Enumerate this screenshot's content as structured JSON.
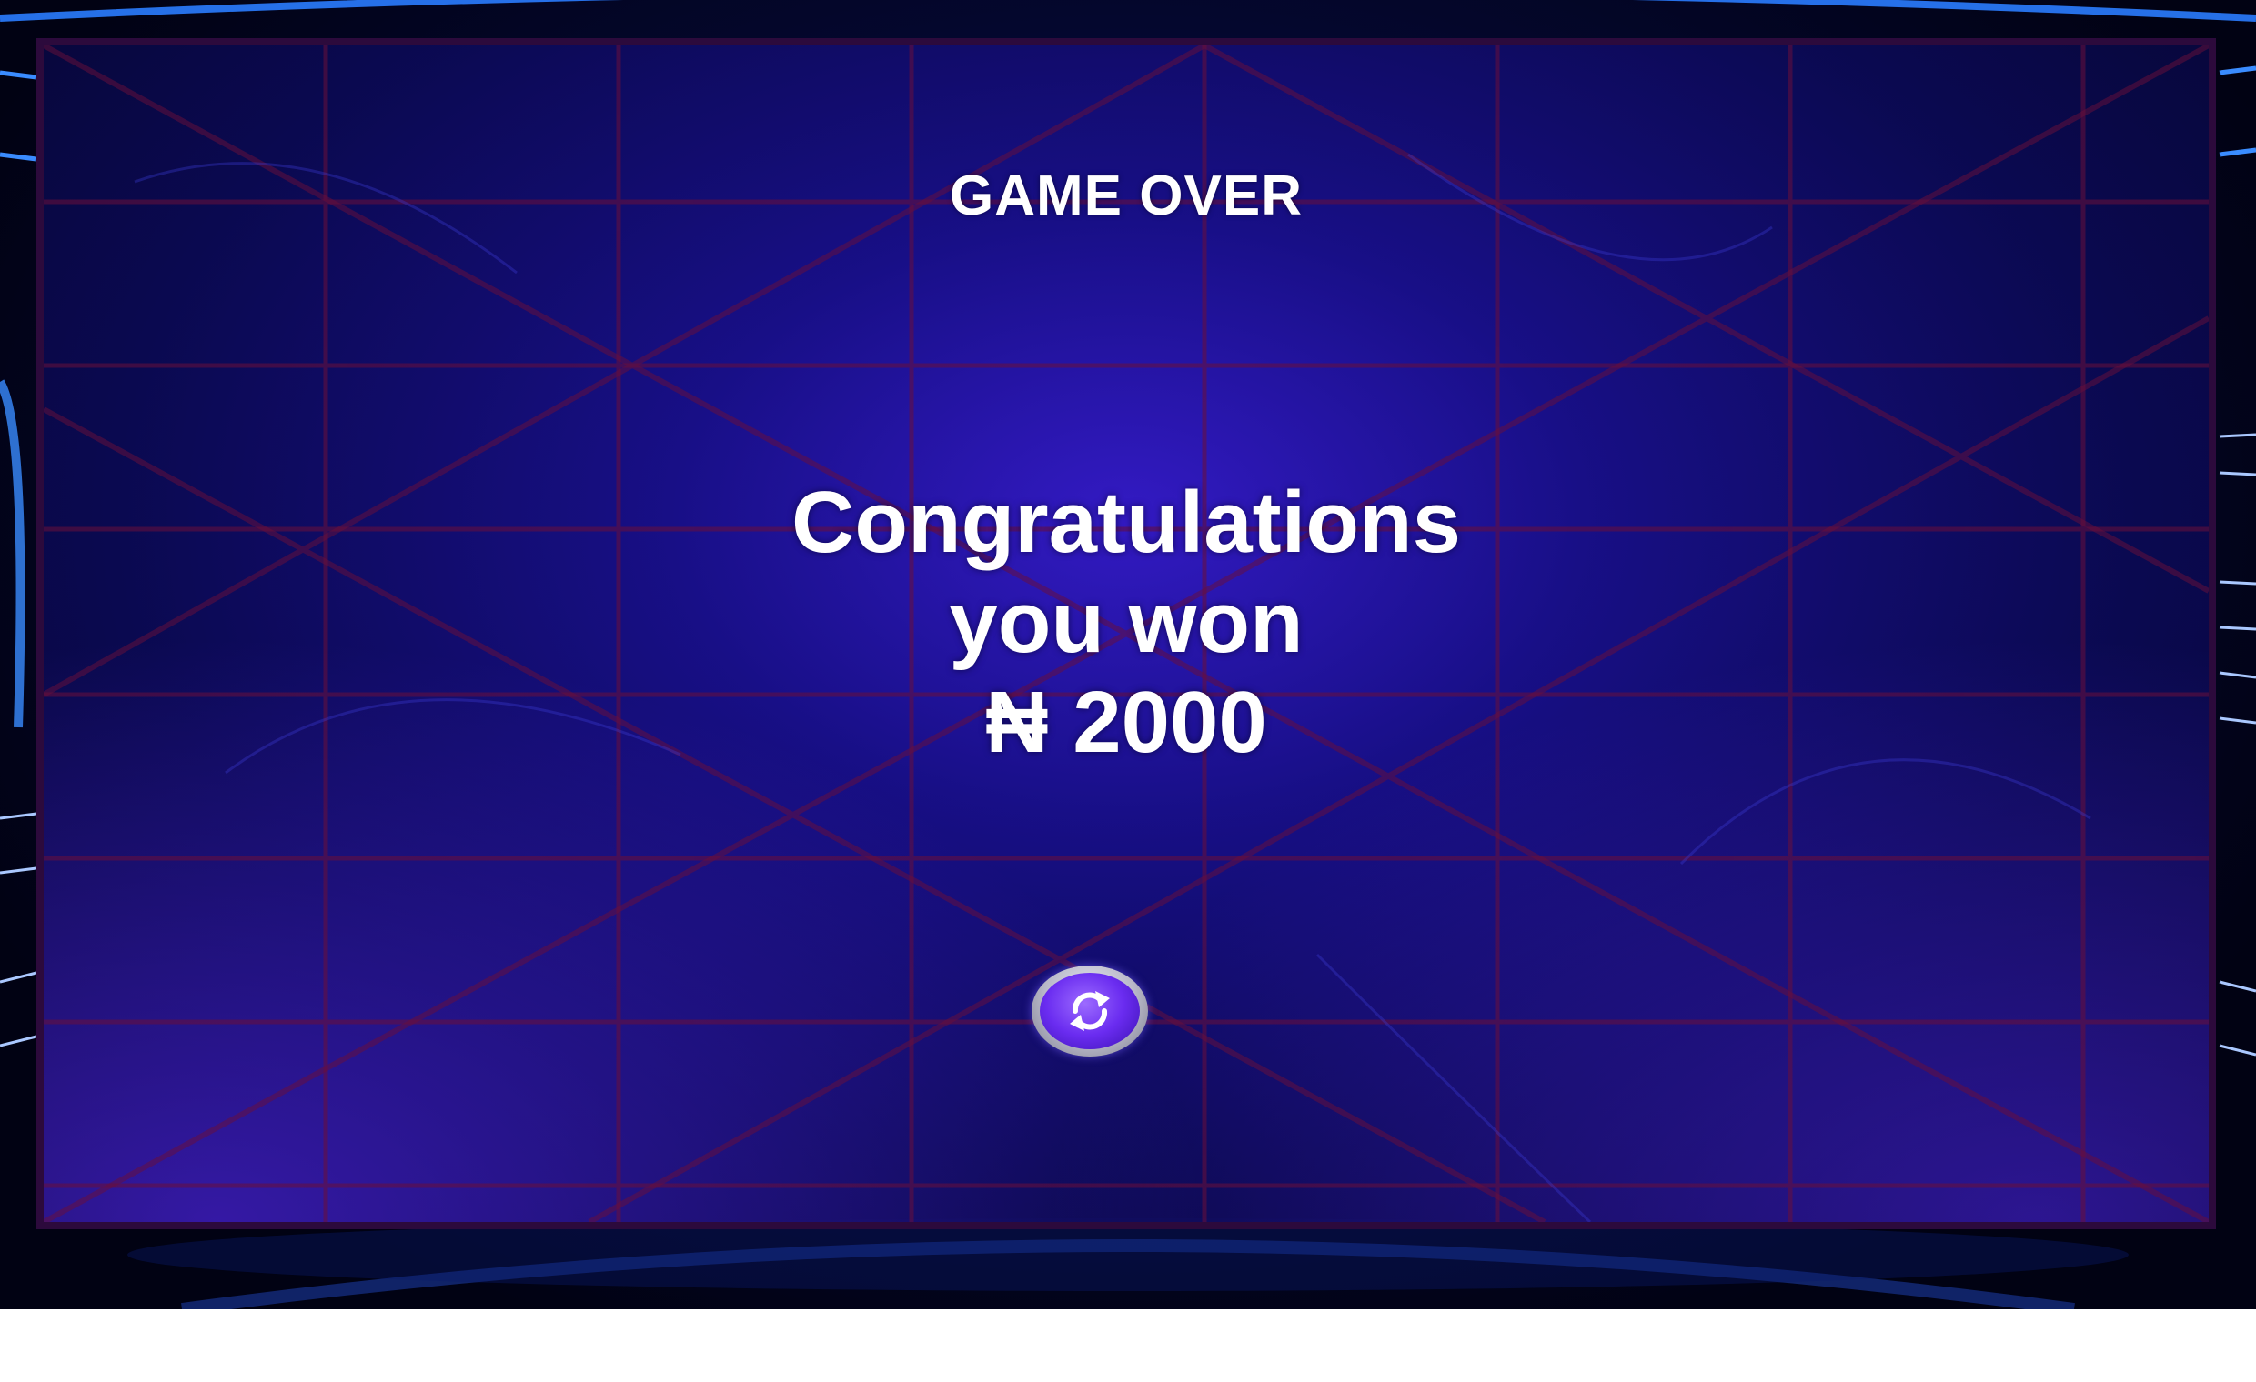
{
  "screen": {
    "title": "GAME OVER",
    "message_line1": "Congratulations",
    "message_line2": "you won",
    "currency_symbol": "₦",
    "prize_amount": "2000"
  },
  "replay_button": {
    "icon": "replay-arrows-icon"
  },
  "colors": {
    "text": "#ffffff",
    "panel_border": "#2c0a3c",
    "grid_lines": "#6a0f3a",
    "button_accent": "#6a2cf0"
  }
}
